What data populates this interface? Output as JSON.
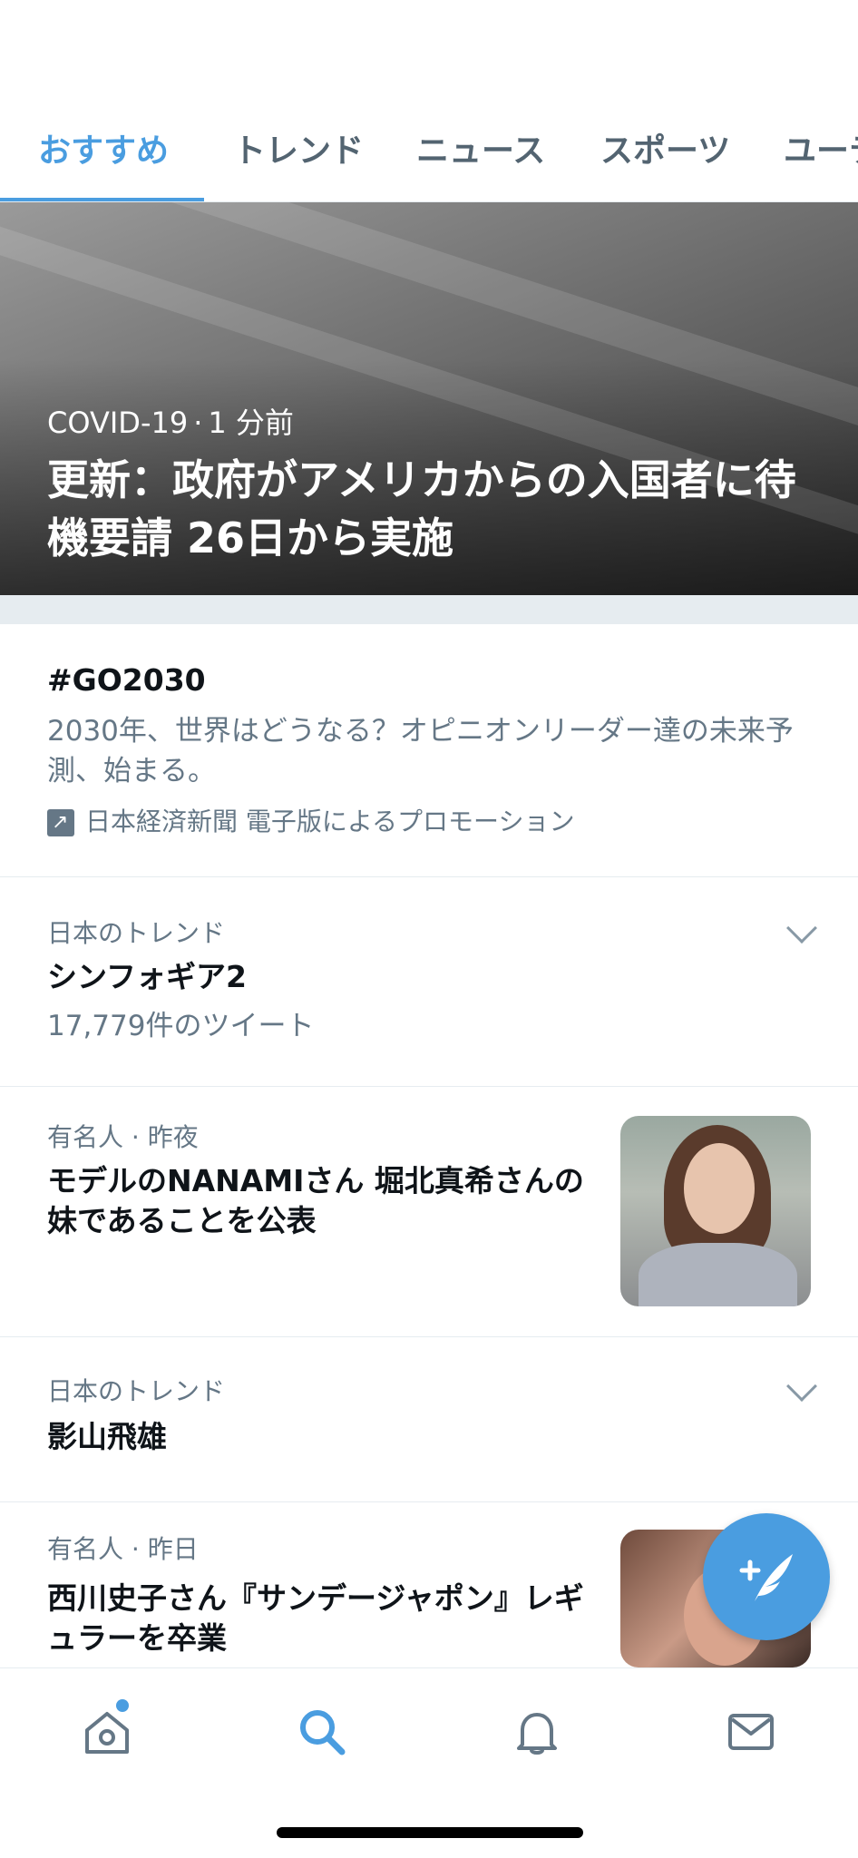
{
  "tabs": [
    {
      "label": "おすすめ",
      "active": true
    },
    {
      "label": "トレンド",
      "active": false
    },
    {
      "label": "ニュース",
      "active": false
    },
    {
      "label": "スポーツ",
      "active": false
    },
    {
      "label": "ユーテ",
      "active": false
    }
  ],
  "hero": {
    "category": "COVID-19",
    "time": "1 分前",
    "title": "更新：政府がアメリカからの入国者に待機要請 26日から実施"
  },
  "promo": {
    "hashtag": "#GO2030",
    "description": "2030年、世界はどうなる？オピニオンリーダー達の未来予測、始まる。",
    "advertiser": "日本経済新聞 電子版によるプロモーション"
  },
  "trend1": {
    "context": "日本のトレンド",
    "title": "シンフォギア2",
    "count": "17,779件のツイート"
  },
  "news1": {
    "context": "有名人 · 昨夜",
    "title": "モデルのNANAMIさん 堀北真希さんの妹であることを公表"
  },
  "trend2": {
    "context": "日本のトレンド",
    "title": "影山飛雄"
  },
  "news2": {
    "context": "有名人 · 昨日",
    "title": "西川史子さん『サンデージャポン』レギュラーを卒業"
  },
  "fab": {
    "icon": "compose-tweet-icon",
    "label": "+"
  },
  "colors": {
    "accent": "#4a9de0",
    "text": "#0f1419",
    "secondary": "#657786",
    "divider": "#e6ecf0"
  },
  "nav": [
    "home-icon",
    "search-icon",
    "bell-icon",
    "mail-icon"
  ]
}
